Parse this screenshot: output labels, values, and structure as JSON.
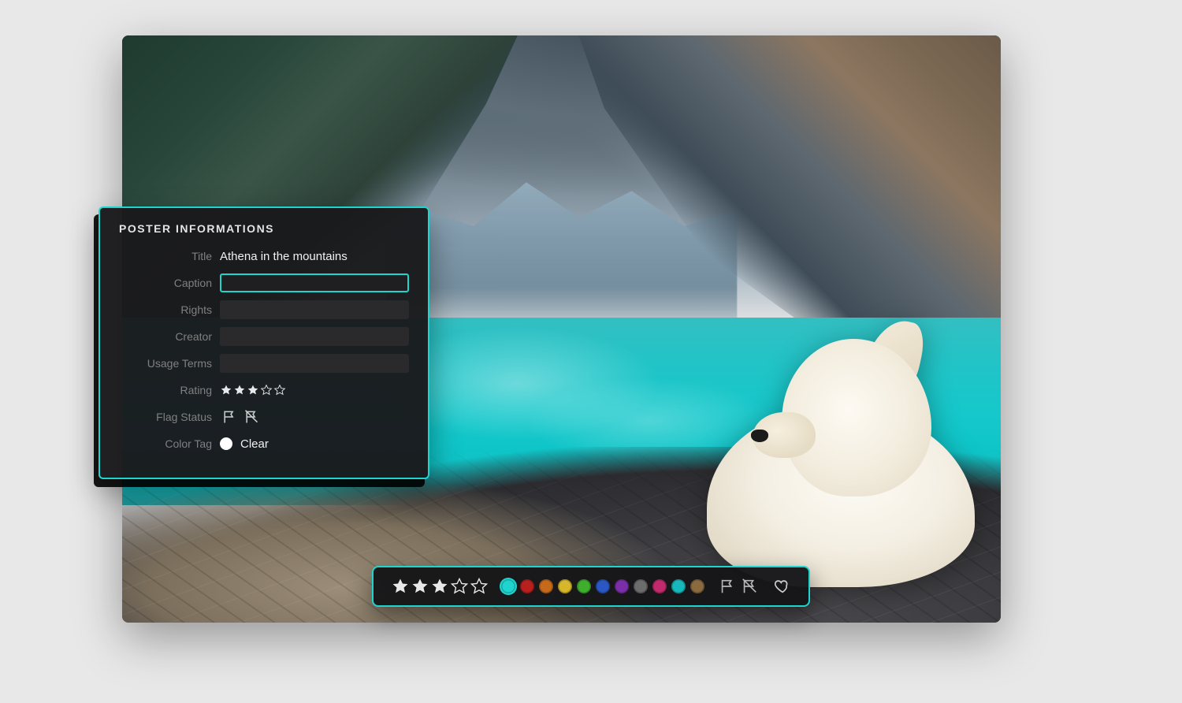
{
  "panel": {
    "heading": "POSTER INFORMATIONS",
    "labels": {
      "title": "Title",
      "caption": "Caption",
      "rights": "Rights",
      "creator": "Creator",
      "usage_terms": "Usage Terms",
      "rating": "Rating",
      "flag_status": "Flag Status",
      "color_tag": "Color Tag"
    },
    "values": {
      "title": "Athena in the mountains",
      "caption": "",
      "rights": "",
      "creator": "",
      "usage_terms": "",
      "rating": 3,
      "rating_max": 5,
      "color_tag": "Clear"
    }
  },
  "toolbar": {
    "rating": 3,
    "rating_max": 5,
    "colors": [
      {
        "name": "teal",
        "hex": "#1fd4cf",
        "selected": true
      },
      {
        "name": "red",
        "hex": "#b8201e",
        "selected": false
      },
      {
        "name": "orange",
        "hex": "#c46a1a",
        "selected": false
      },
      {
        "name": "yellow",
        "hex": "#d6b62a",
        "selected": false
      },
      {
        "name": "green",
        "hex": "#3fae2f",
        "selected": false
      },
      {
        "name": "blue",
        "hex": "#2a57c4",
        "selected": false
      },
      {
        "name": "purple",
        "hex": "#7a2fa8",
        "selected": false
      },
      {
        "name": "gray",
        "hex": "#6c6c6c",
        "selected": false
      },
      {
        "name": "magenta",
        "hex": "#c12a6c",
        "selected": false
      },
      {
        "name": "cyan",
        "hex": "#17b8bb",
        "selected": false
      },
      {
        "name": "brown",
        "hex": "#8a6a3e",
        "selected": false
      }
    ]
  }
}
